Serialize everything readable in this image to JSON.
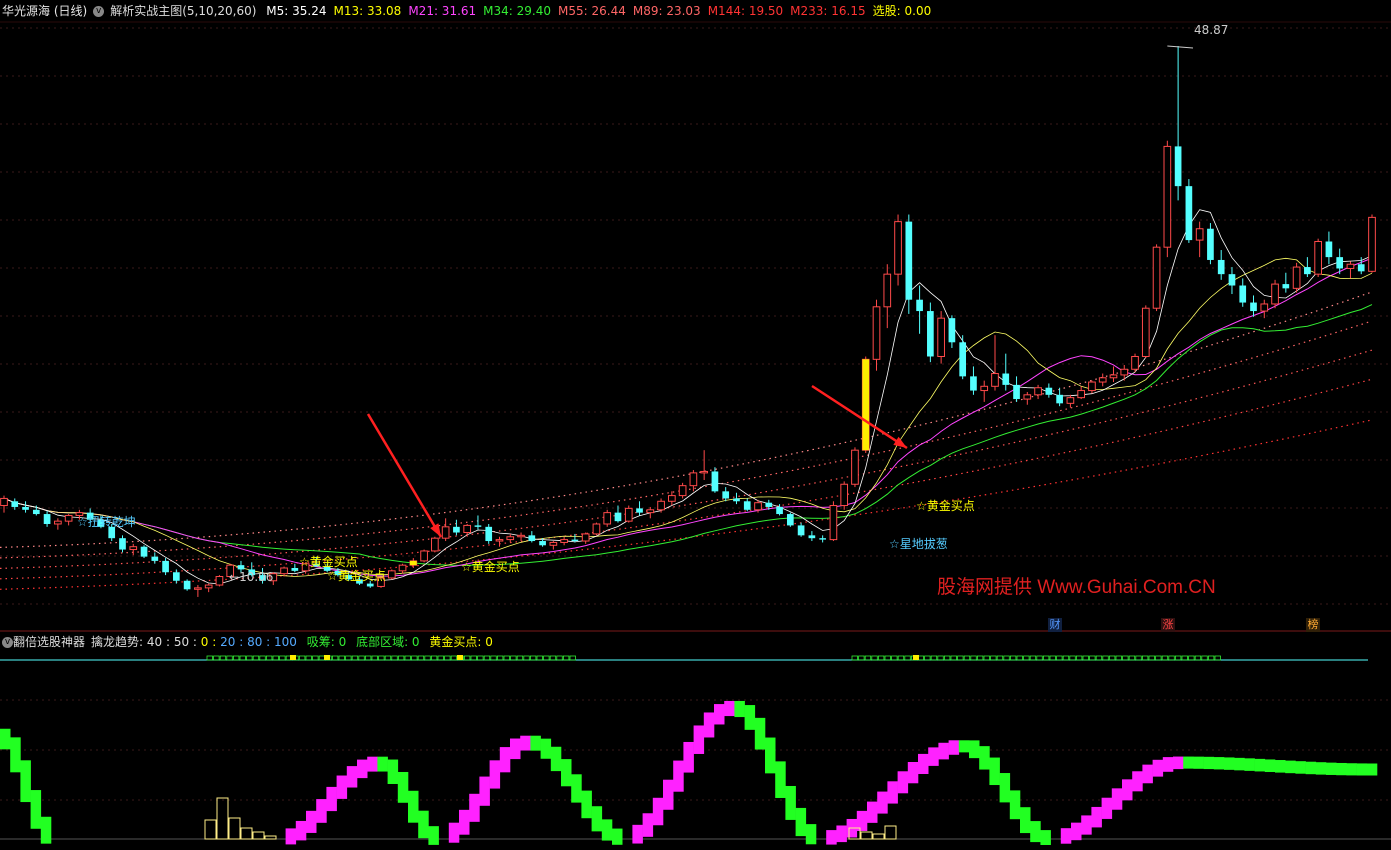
{
  "header": {
    "stock_name": "华光源海 (日线)",
    "indicator_name": "解析实战主图(5,10,20,60)",
    "ma": [
      {
        "label": "M5: 35.24",
        "color": "#ffffff"
      },
      {
        "label": "M13: 33.08",
        "color": "#ffff00"
      },
      {
        "label": "M21: 31.61",
        "color": "#ff44ff"
      },
      {
        "label": "M34: 29.40",
        "color": "#33ee33"
      },
      {
        "label": "M55: 26.44",
        "color": "#ff6666"
      },
      {
        "label": "M89: 23.03",
        "color": "#ff6666"
      },
      {
        "label": "M144: 19.50",
        "color": "#ff3333"
      },
      {
        "label": "M233: 16.15",
        "color": "#ff3333"
      },
      {
        "label": "选股: 0.00",
        "color": "#ffff00"
      }
    ]
  },
  "chart_labels": {
    "max_price": "48.87",
    "min_price": "10.06",
    "watermark": "股海网提供 Www.Guhai.Com.CN",
    "signals": [
      {
        "text": "☆扭转乾坤",
        "color": "#55ccff",
        "id": "sig-1"
      },
      {
        "text": "☆黄金买点",
        "color": "#ffff00",
        "id": "sig-2"
      },
      {
        "text": "☆黄金买点",
        "color": "#ffff00",
        "id": "sig-3"
      },
      {
        "text": "☆黄金买点",
        "color": "#ffff00",
        "id": "sig-4"
      },
      {
        "text": "☆黄金买点",
        "color": "#ffff00",
        "id": "sig-5"
      },
      {
        "text": "☆星地拔葱",
        "color": "#55ccff",
        "id": "sig-6"
      }
    ],
    "badges": [
      {
        "text": "财",
        "color": "#5599ff"
      },
      {
        "text": "涨",
        "color": "#ff4444"
      },
      {
        "text": "榜",
        "color": "#ffaa33"
      }
    ]
  },
  "lower_header": {
    "name": "翻倍选股神器",
    "trend_label": "擒龙趋势:",
    "trend_values": [
      "40",
      "50",
      "0",
      "20",
      "80",
      "100"
    ],
    "trend_colors": [
      "#dddddd",
      "#dddddd",
      "#ffff00",
      "#55aaff",
      "#55aaff",
      "#55aaff"
    ],
    "xichou": "吸筹: 0",
    "bottom_area": "底部区域: 0",
    "gold_buy": "黄金买点: 0"
  },
  "chart_data": {
    "type": "candlestick",
    "y_range": [
      9,
      50
    ],
    "candles": [
      [
        16.5,
        17.2,
        16.0,
        17.0
      ],
      [
        16.8,
        17.0,
        16.2,
        16.4
      ],
      [
        16.4,
        16.8,
        16.0,
        16.2
      ],
      [
        16.2,
        16.5,
        15.8,
        15.9
      ],
      [
        15.9,
        16.1,
        15.0,
        15.2
      ],
      [
        15.2,
        15.6,
        14.8,
        15.4
      ],
      [
        15.4,
        15.9,
        15.1,
        15.8
      ],
      [
        15.8,
        16.2,
        15.5,
        16.0
      ],
      [
        16.0,
        16.3,
        15.4,
        15.5
      ],
      [
        15.5,
        15.8,
        14.9,
        15.0
      ],
      [
        15.0,
        15.2,
        14.0,
        14.2
      ],
      [
        14.2,
        14.4,
        13.2,
        13.4
      ],
      [
        13.4,
        13.8,
        13.0,
        13.6
      ],
      [
        13.6,
        13.7,
        12.8,
        12.9
      ],
      [
        12.9,
        13.2,
        12.4,
        12.6
      ],
      [
        12.6,
        12.8,
        11.6,
        11.8
      ],
      [
        11.8,
        12.0,
        11.0,
        11.2
      ],
      [
        11.2,
        11.3,
        10.5,
        10.6
      ],
      [
        10.6,
        10.9,
        10.06,
        10.7
      ],
      [
        10.7,
        11.0,
        10.4,
        10.9
      ],
      [
        10.9,
        11.6,
        10.8,
        11.5
      ],
      [
        11.5,
        12.4,
        11.4,
        12.3
      ],
      [
        12.3,
        12.6,
        11.8,
        12.0
      ],
      [
        12.0,
        12.5,
        11.5,
        11.6
      ],
      [
        11.6,
        12.1,
        11.0,
        11.2
      ],
      [
        11.2,
        11.8,
        10.9,
        11.7
      ],
      [
        11.7,
        12.2,
        11.5,
        12.1
      ],
      [
        12.1,
        12.4,
        11.8,
        11.9
      ],
      [
        11.9,
        12.5,
        11.7,
        12.4
      ],
      [
        12.4,
        12.9,
        12.2,
        12.2
      ],
      [
        12.2,
        12.4,
        11.8,
        11.9
      ],
      [
        11.9,
        12.1,
        11.5,
        11.6
      ],
      [
        11.6,
        11.8,
        11.2,
        11.3
      ],
      [
        11.3,
        11.5,
        10.9,
        11.0
      ],
      [
        11.0,
        11.2,
        10.7,
        10.8
      ],
      [
        10.8,
        11.5,
        10.7,
        11.4
      ],
      [
        11.4,
        12.0,
        11.3,
        11.9
      ],
      [
        11.9,
        12.4,
        11.7,
        12.3
      ],
      [
        12.3,
        12.8,
        12.1,
        12.6
      ],
      [
        12.6,
        13.4,
        12.5,
        13.3
      ],
      [
        13.3,
        14.3,
        13.2,
        14.2
      ],
      [
        14.2,
        15.6,
        14.0,
        15.0
      ],
      [
        15.0,
        15.5,
        14.4,
        14.6
      ],
      [
        14.6,
        15.2,
        14.3,
        15.1
      ],
      [
        15.1,
        15.8,
        14.8,
        15.0
      ],
      [
        15.0,
        15.2,
        13.8,
        14.0
      ],
      [
        14.0,
        14.3,
        13.6,
        14.1
      ],
      [
        14.1,
        14.5,
        13.9,
        14.3
      ],
      [
        14.3,
        14.6,
        14.0,
        14.4
      ],
      [
        14.4,
        14.7,
        13.9,
        14.0
      ],
      [
        14.0,
        14.2,
        13.6,
        13.7
      ],
      [
        13.7,
        14.0,
        13.4,
        13.9
      ],
      [
        13.9,
        14.3,
        13.7,
        14.1
      ],
      [
        14.1,
        14.5,
        13.9,
        14.0
      ],
      [
        14.0,
        14.6,
        13.8,
        14.5
      ],
      [
        14.5,
        15.3,
        14.4,
        15.2
      ],
      [
        15.2,
        16.2,
        15.0,
        16.0
      ],
      [
        16.0,
        16.5,
        15.3,
        15.4
      ],
      [
        15.4,
        16.5,
        15.3,
        16.3
      ],
      [
        16.3,
        16.8,
        15.8,
        16.0
      ],
      [
        16.0,
        16.4,
        15.6,
        16.2
      ],
      [
        16.2,
        17.0,
        16.0,
        16.8
      ],
      [
        16.8,
        17.5,
        16.5,
        17.2
      ],
      [
        17.2,
        18.1,
        17.0,
        17.9
      ],
      [
        17.9,
        19.0,
        17.5,
        18.8
      ],
      [
        18.8,
        20.4,
        18.3,
        18.9
      ],
      [
        18.9,
        19.2,
        17.4,
        17.5
      ],
      [
        17.5,
        17.8,
        16.8,
        17.0
      ],
      [
        17.0,
        17.4,
        16.6,
        16.8
      ],
      [
        16.8,
        17.0,
        16.1,
        16.2
      ],
      [
        16.2,
        16.9,
        16.0,
        16.7
      ],
      [
        16.7,
        16.9,
        16.2,
        16.4
      ],
      [
        16.4,
        16.6,
        15.8,
        15.9
      ],
      [
        15.9,
        16.0,
        15.0,
        15.1
      ],
      [
        15.1,
        15.3,
        14.3,
        14.4
      ],
      [
        14.4,
        14.7,
        14.0,
        14.2
      ],
      [
        14.2,
        14.4,
        13.9,
        14.1
      ],
      [
        14.1,
        16.8,
        14.0,
        16.5
      ],
      [
        16.5,
        18.2,
        16.2,
        18.0
      ],
      [
        18.0,
        20.6,
        17.8,
        20.4
      ],
      [
        20.4,
        27.0,
        20.2,
        26.8
      ],
      [
        26.8,
        31.0,
        26.0,
        30.5
      ],
      [
        30.5,
        33.5,
        29.0,
        32.8
      ],
      [
        32.8,
        37.0,
        32.0,
        36.5
      ],
      [
        36.5,
        37.0,
        30.0,
        31.0
      ],
      [
        31.0,
        32.0,
        28.6,
        30.2
      ],
      [
        30.2,
        30.8,
        26.6,
        27.0
      ],
      [
        27.0,
        30.2,
        26.5,
        29.7
      ],
      [
        29.7,
        29.9,
        27.6,
        28.0
      ],
      [
        28.0,
        28.5,
        25.4,
        25.6
      ],
      [
        25.6,
        26.3,
        24.3,
        24.6
      ],
      [
        24.6,
        25.3,
        23.8,
        24.9
      ],
      [
        24.9,
        28.5,
        24.6,
        25.8
      ],
      [
        25.8,
        27.2,
        24.6,
        25.0
      ],
      [
        25.0,
        25.6,
        23.8,
        24.0
      ],
      [
        24.0,
        24.5,
        23.6,
        24.3
      ],
      [
        24.3,
        25.0,
        24.0,
        24.8
      ],
      [
        24.8,
        25.1,
        24.1,
        24.3
      ],
      [
        24.3,
        24.8,
        23.5,
        23.7
      ],
      [
        23.7,
        24.3,
        23.4,
        24.1
      ],
      [
        24.1,
        24.9,
        24.0,
        24.6
      ],
      [
        24.6,
        25.3,
        24.4,
        25.2
      ],
      [
        25.2,
        25.8,
        24.9,
        25.5
      ],
      [
        25.5,
        26.3,
        25.2,
        25.7
      ],
      [
        25.7,
        26.4,
        25.3,
        26.1
      ],
      [
        26.1,
        27.2,
        25.9,
        27.0
      ],
      [
        27.0,
        30.6,
        26.9,
        30.4
      ],
      [
        30.4,
        34.9,
        30.2,
        34.7
      ],
      [
        34.7,
        42.2,
        34.0,
        41.8
      ],
      [
        41.8,
        48.87,
        38.0,
        39.0
      ],
      [
        39.0,
        39.5,
        35.0,
        35.2
      ],
      [
        35.2,
        36.5,
        34.0,
        36.0
      ],
      [
        36.0,
        36.4,
        33.5,
        33.8
      ],
      [
        33.8,
        34.5,
        32.4,
        32.8
      ],
      [
        32.8,
        33.3,
        31.4,
        32.0
      ],
      [
        32.0,
        32.5,
        30.5,
        30.8
      ],
      [
        30.8,
        31.3,
        29.8,
        30.2
      ],
      [
        30.2,
        31.0,
        29.7,
        30.7
      ],
      [
        30.7,
        32.4,
        30.4,
        32.1
      ],
      [
        32.1,
        32.9,
        31.5,
        31.8
      ],
      [
        31.8,
        33.6,
        31.5,
        33.3
      ],
      [
        33.3,
        34.0,
        32.6,
        32.8
      ],
      [
        32.8,
        35.3,
        32.6,
        35.1
      ],
      [
        35.1,
        35.8,
        33.5,
        34.0
      ],
      [
        34.0,
        34.6,
        32.8,
        33.2
      ],
      [
        33.2,
        33.7,
        32.5,
        33.5
      ],
      [
        33.5,
        34.0,
        32.8,
        33.0
      ],
      [
        33.0,
        37.0,
        32.9,
        36.8
      ]
    ]
  }
}
